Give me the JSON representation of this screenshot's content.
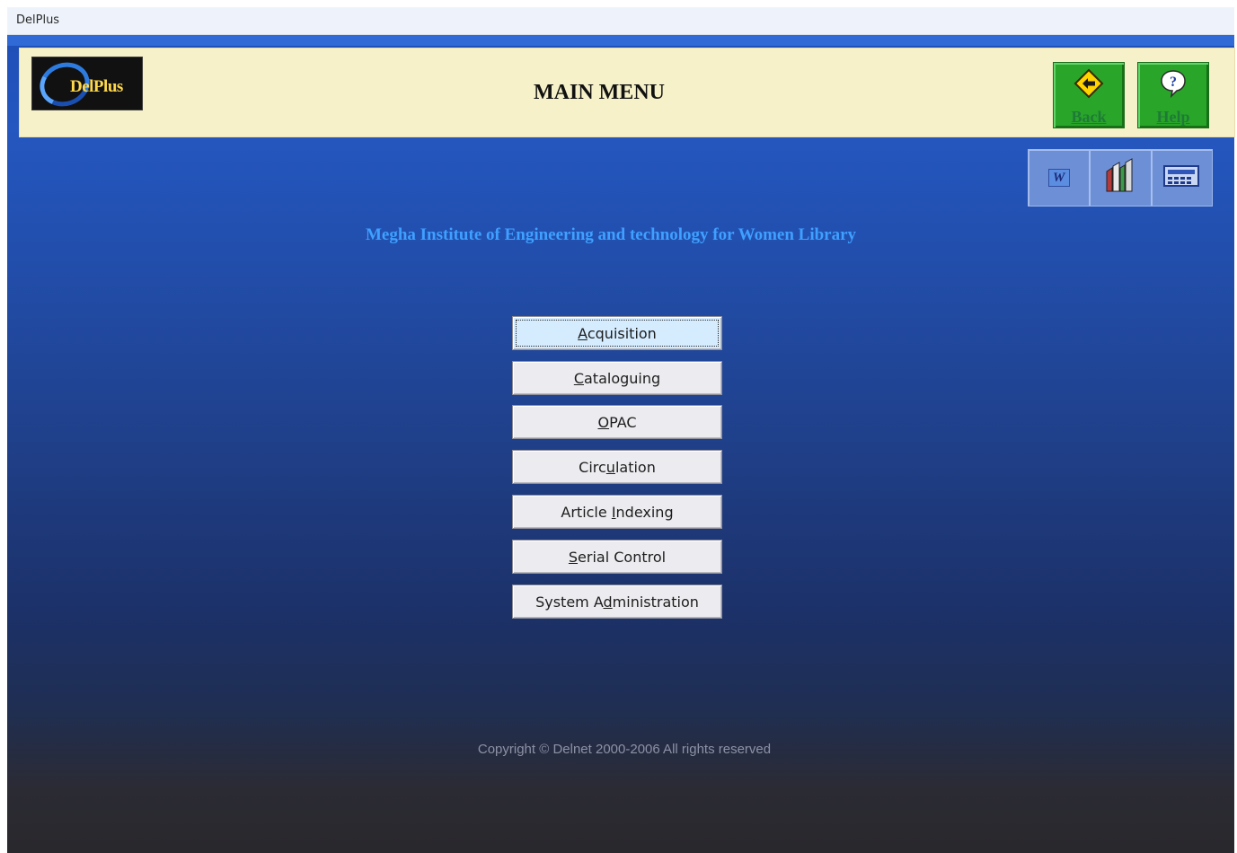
{
  "window": {
    "title": "DelPlus"
  },
  "header": {
    "logo_text": "DelPlus",
    "title": "MAIN MENU",
    "back_label": "Back",
    "help_label": "Help"
  },
  "toolbar": {
    "icons": [
      "word-icon",
      "books-icon",
      "calculator-icon"
    ],
    "word_glyph": "W"
  },
  "institute_name": "Megha Institute of Engineering and technology for Women  Library",
  "menu": {
    "items": [
      {
        "label": "Acquisition",
        "accel": "A",
        "active": true
      },
      {
        "label": "Cataloguing",
        "accel": "C"
      },
      {
        "label": "OPAC",
        "accel": "O"
      },
      {
        "label": "Circulation",
        "accel": "u"
      },
      {
        "label": "Article Indexing",
        "accel": "I"
      },
      {
        "label": "Serial Control",
        "accel": "S"
      },
      {
        "label": "System Administration",
        "accel": "d"
      }
    ]
  },
  "footer": {
    "copyright": "Copyright © Delnet 2000-2006  All rights reserved"
  },
  "colors": {
    "header_bg": "#f7f1c9",
    "action_green": "#29a52a",
    "institute_text": "#3fa0ff",
    "title_blue": "#2f6ad6"
  }
}
